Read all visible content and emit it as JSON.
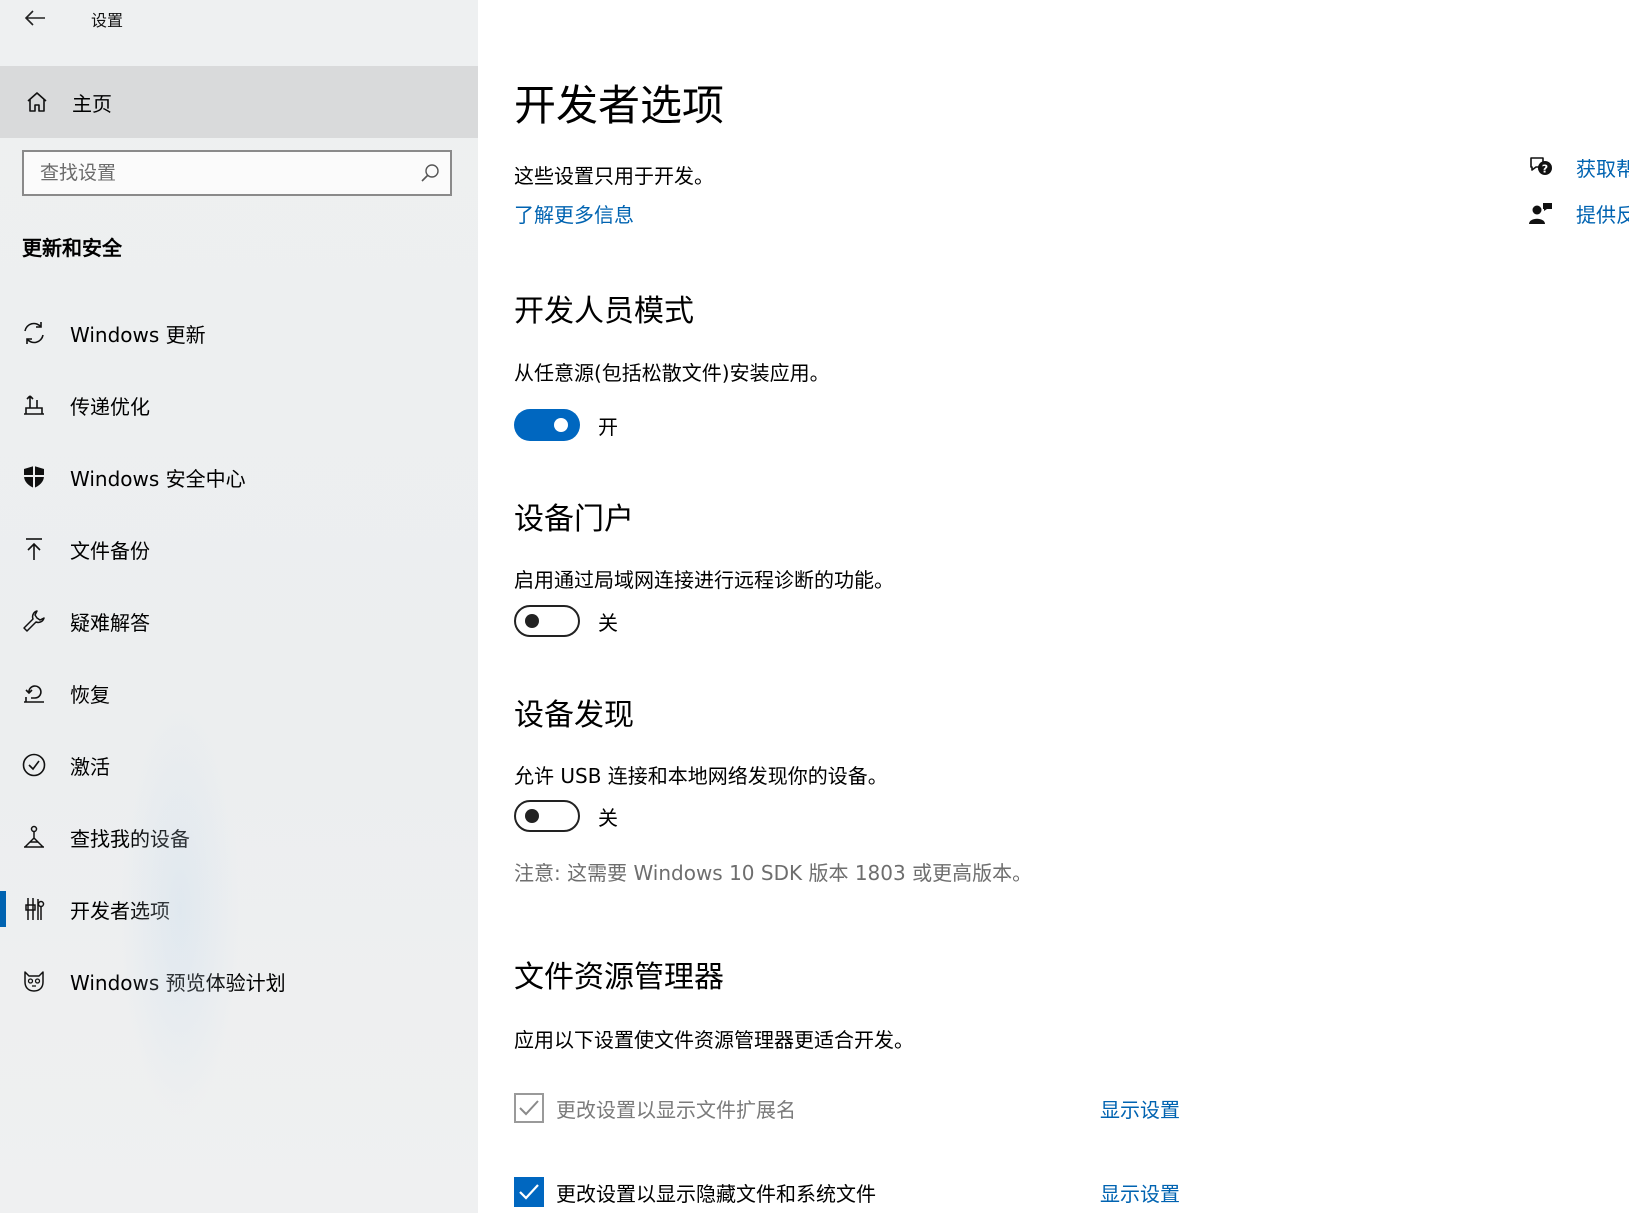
{
  "window": {
    "title": "设置"
  },
  "sidebar": {
    "home_label": "主页",
    "search_placeholder": "查找设置",
    "section_title": "更新和安全",
    "items": [
      {
        "label": "Windows 更新",
        "icon": "sync-icon"
      },
      {
        "label": "传递优化",
        "icon": "delivery-optimization-icon"
      },
      {
        "label": "Windows 安全中心",
        "icon": "shield-icon"
      },
      {
        "label": "文件备份",
        "icon": "backup-arrow-icon"
      },
      {
        "label": "疑难解答",
        "icon": "wrench-icon"
      },
      {
        "label": "恢复",
        "icon": "recovery-icon"
      },
      {
        "label": "激活",
        "icon": "check-circle-icon"
      },
      {
        "label": "查找我的设备",
        "icon": "find-device-icon"
      },
      {
        "label": "开发者选项",
        "icon": "developer-icon",
        "active": true
      },
      {
        "label": "Windows 预览体验计划",
        "icon": "insider-cat-icon"
      }
    ],
    "accent_color": "#0063b1"
  },
  "main": {
    "title": "开发者选项",
    "intro": "这些设置只用于开发。",
    "learn_more": "了解更多信息",
    "developer_mode": {
      "heading": "开发人员模式",
      "description": "从任意源(包括松散文件)安装应用。",
      "state_label": "开",
      "on": true
    },
    "device_portal": {
      "heading": "设备门户",
      "description": "启用通过局域网连接进行远程诊断的功能。",
      "state_label": "关",
      "on": false
    },
    "device_discovery": {
      "heading": "设备发现",
      "description": "允许 USB 连接和本地网络发现你的设备。",
      "state_label": "关",
      "on": false,
      "note": "注意: 这需要 Windows 10 SDK 版本 1803 或更高版本。"
    },
    "file_explorer": {
      "heading": "文件资源管理器",
      "description": "应用以下设置使文件资源管理器更适合开发。",
      "options": [
        {
          "label": "更改设置以显示文件扩展名",
          "checked": true,
          "disabled": true,
          "link": "显示设置"
        },
        {
          "label": "更改设置以显示隐藏文件和系统文件",
          "checked": true,
          "disabled": false,
          "link": "显示设置"
        }
      ]
    }
  },
  "help": {
    "get_help": "获取帮",
    "feedback": "提供反"
  }
}
